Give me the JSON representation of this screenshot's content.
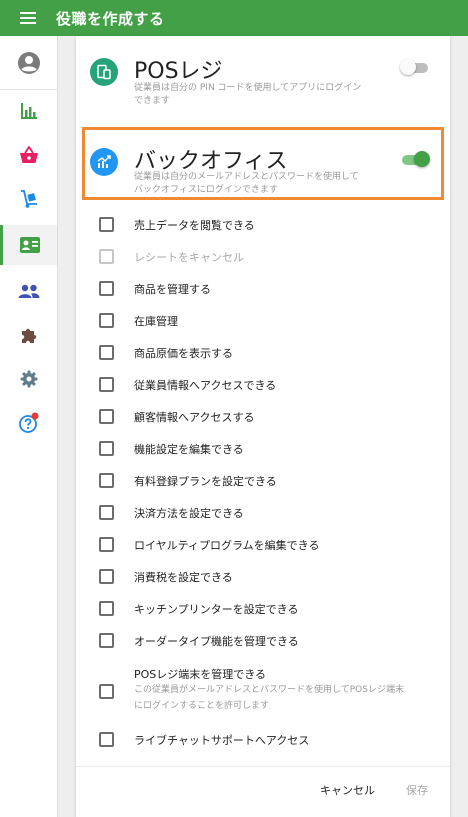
{
  "colors": {
    "brand_green": "#43a047",
    "highlight_orange": "#f08a32",
    "pos_icon_bg": "#26a37a",
    "backoffice_icon_bg": "#2196f3"
  },
  "header": {
    "menu_icon": "hamburger-menu-icon",
    "title": "役職を作成する"
  },
  "sidebar": {
    "items": [
      {
        "name": "account",
        "icon": "account-circle-icon"
      },
      {
        "name": "reports",
        "icon": "bar-chart-icon"
      },
      {
        "name": "sales",
        "icon": "shopping-basket-icon"
      },
      {
        "name": "inventory",
        "icon": "hand-truck-icon"
      },
      {
        "name": "employees",
        "icon": "badge-icon",
        "active": true
      },
      {
        "name": "customers",
        "icon": "people-icon"
      },
      {
        "name": "integrations",
        "icon": "puzzle-icon"
      },
      {
        "name": "settings",
        "icon": "gear-icon"
      },
      {
        "name": "help",
        "icon": "help-circle-icon",
        "has_notification": true
      }
    ]
  },
  "pos_module": {
    "title": "POSレジ",
    "desc_line1": "従業員は自分の PIN コードを使用してアプリにログイン",
    "desc_line2": "できます",
    "enabled": false
  },
  "backoffice_module": {
    "title": "バックオフィス",
    "desc_line1": "従業員は自分のメールアドレスとパスワードを使用して",
    "desc_line2": "バックオフィスにログインできます",
    "enabled": true
  },
  "permissions": [
    {
      "label": "売上データを閲覧できる",
      "checked": false,
      "disabled": false
    },
    {
      "label": "レシートをキャンセル",
      "checked": false,
      "disabled": true
    },
    {
      "label": "商品を管理する",
      "checked": false,
      "disabled": false
    },
    {
      "label": "在庫管理",
      "checked": false,
      "disabled": false
    },
    {
      "label": "商品原価を表示する",
      "checked": false,
      "disabled": false
    },
    {
      "label": "従業員情報へアクセスできる",
      "checked": false,
      "disabled": false
    },
    {
      "label": "顧客情報へアクセスする",
      "checked": false,
      "disabled": false
    },
    {
      "label": "機能設定を編集できる",
      "checked": false,
      "disabled": false
    },
    {
      "label": "有料登録プランを設定できる",
      "checked": false,
      "disabled": false
    },
    {
      "label": "決済方法を設定できる",
      "checked": false,
      "disabled": false
    },
    {
      "label": "ロイヤルティプログラムを編集できる",
      "checked": false,
      "disabled": false
    },
    {
      "label": "消費税を設定できる",
      "checked": false,
      "disabled": false
    },
    {
      "label": "キッチンプリンターを設定できる",
      "checked": false,
      "disabled": false
    },
    {
      "label": "オーダータイプ機能を管理できる",
      "checked": false,
      "disabled": false
    },
    {
      "label": "POSレジ端末を管理できる",
      "sub_line1": "この従業員がメールアドレスとパスワードを使用してPOSレジ端末",
      "sub_line2": "にログインすることを許可します",
      "checked": false,
      "disabled": false
    },
    {
      "label": "ライブチャットサポートへアクセス",
      "checked": false,
      "disabled": false
    }
  ],
  "footer": {
    "cancel_label": "キャンセル",
    "save_label": "保存"
  }
}
